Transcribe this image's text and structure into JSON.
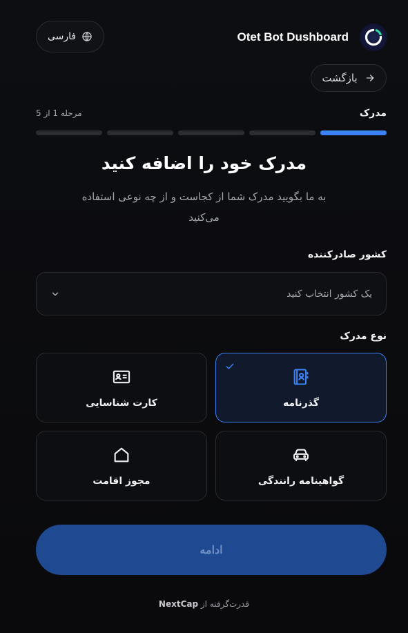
{
  "header": {
    "app_title": "Otet Bot Dushboard",
    "language_label": "فارسی",
    "back_label": "بازگشت"
  },
  "steps": {
    "current_label": "مدرک",
    "counter": "مرحله 1 از 5",
    "total": 5,
    "current": 1
  },
  "heading": {
    "title": "مدرک خود را اضافه کنید",
    "subtitle": "به ما بگویید مدرک شما از کجاست و از چه نوعی استفاده می‌کنید"
  },
  "country": {
    "label": "کشور صادرکننده",
    "placeholder": "یک کشور انتخاب کنید"
  },
  "document_type": {
    "label": "نوع مدرک",
    "options": [
      {
        "label": "گذرنامه",
        "icon": "passport-icon",
        "selected": true
      },
      {
        "label": "کارت شناسایی",
        "icon": "id-card-icon",
        "selected": false
      },
      {
        "label": "گواهینامه رانندگی",
        "icon": "car-icon",
        "selected": false
      },
      {
        "label": "مجوز اقامت",
        "icon": "home-icon",
        "selected": false
      }
    ]
  },
  "actions": {
    "continue_label": "ادامه"
  },
  "footer": {
    "powered_prefix": "قدرت‌گرفته از",
    "brand": "NextCap"
  },
  "colors": {
    "accent": "#3b82f6",
    "button_bg": "#1f4a92",
    "background": "#0b0b0d"
  }
}
